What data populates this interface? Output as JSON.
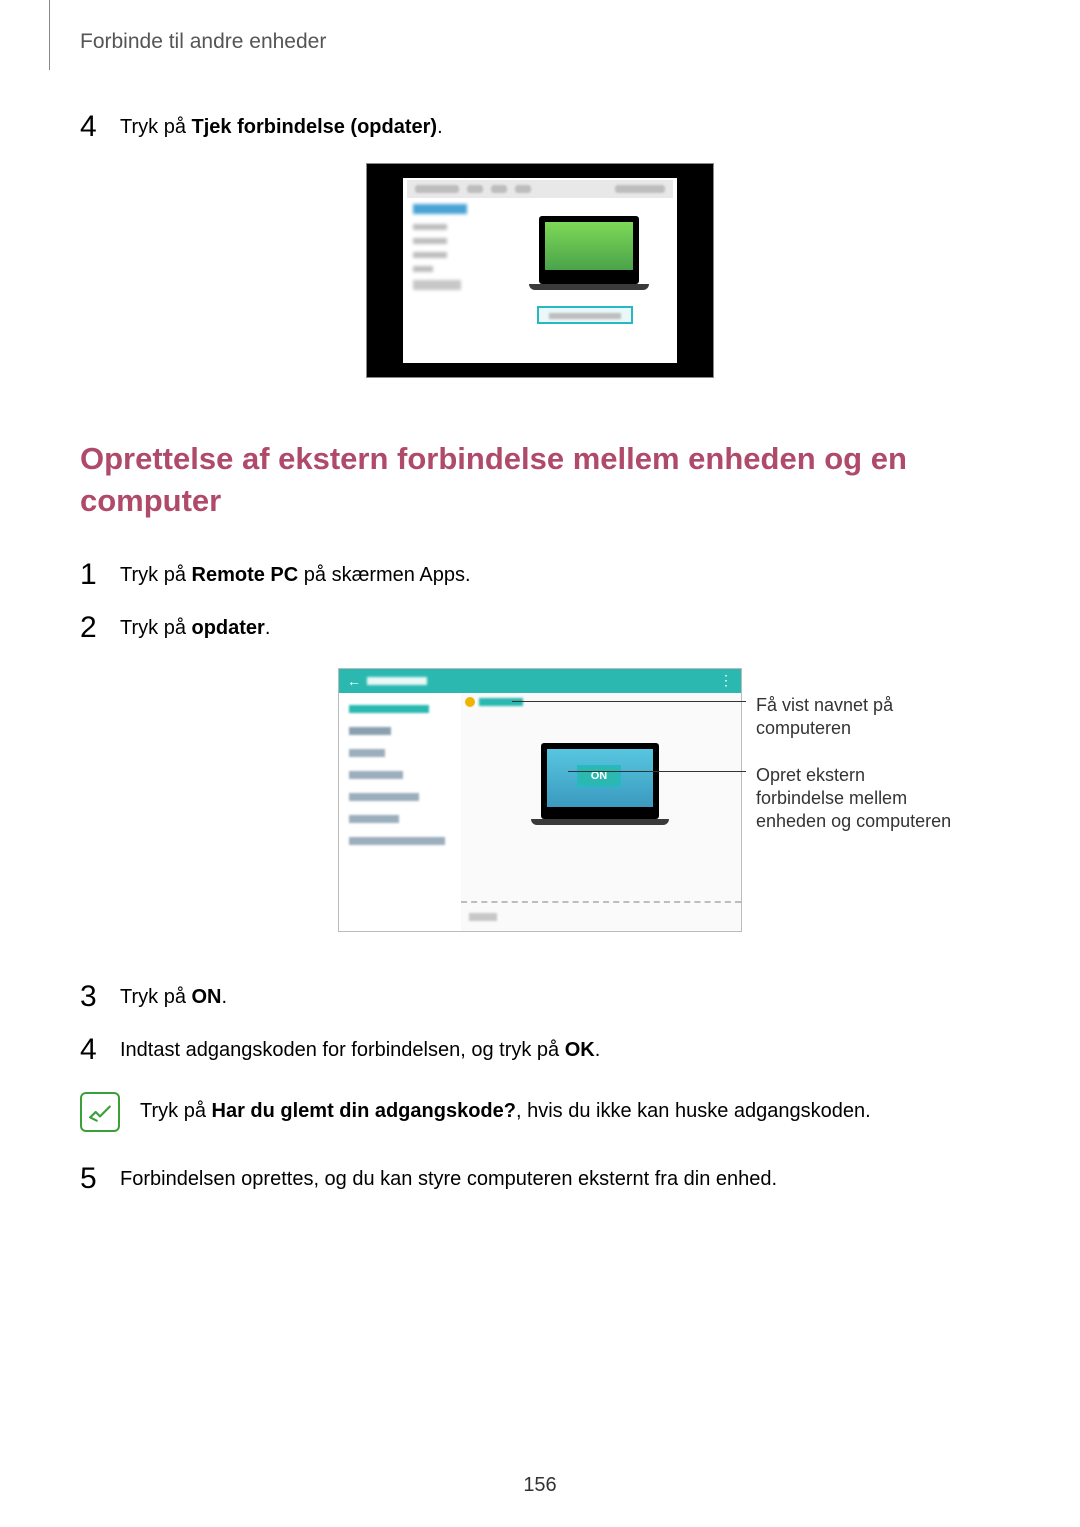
{
  "header": "Forbinde til andre enheder",
  "pre_step": {
    "num": "4",
    "prefix": "Tryk på ",
    "bold": "Tjek forbindelse (opdater)",
    "suffix": "."
  },
  "section_heading": "Oprettelse af ekstern forbindelse mellem enheden og en computer",
  "steps": [
    {
      "num": "1",
      "prefix": "Tryk på ",
      "bold": "Remote PC",
      "suffix": " på skærmen Apps."
    },
    {
      "num": "2",
      "prefix": "Tryk på ",
      "bold": "opdater",
      "suffix": "."
    },
    {
      "num": "3",
      "prefix": "Tryk på ",
      "bold": "ON",
      "suffix": "."
    },
    {
      "num": "4",
      "prefix": "Indtast adgangskoden for forbindelsen, og tryk på ",
      "bold": "OK",
      "suffix": "."
    },
    {
      "num": "5",
      "prefix": "Forbindelsen oprettes, og du kan styre computeren eksternt fra din enhed.",
      "bold": "",
      "suffix": ""
    }
  ],
  "callouts": {
    "c1": "Få vist navnet på computeren",
    "c2": "Opret ekstern forbindelse mellem enheden og computeren"
  },
  "on_label": "ON",
  "note": {
    "prefix": "Tryk på ",
    "bold": "Har du glemt din adgangskode?",
    "suffix": ", hvis du ikke kan huske adgangskoden."
  },
  "page_number": "156"
}
